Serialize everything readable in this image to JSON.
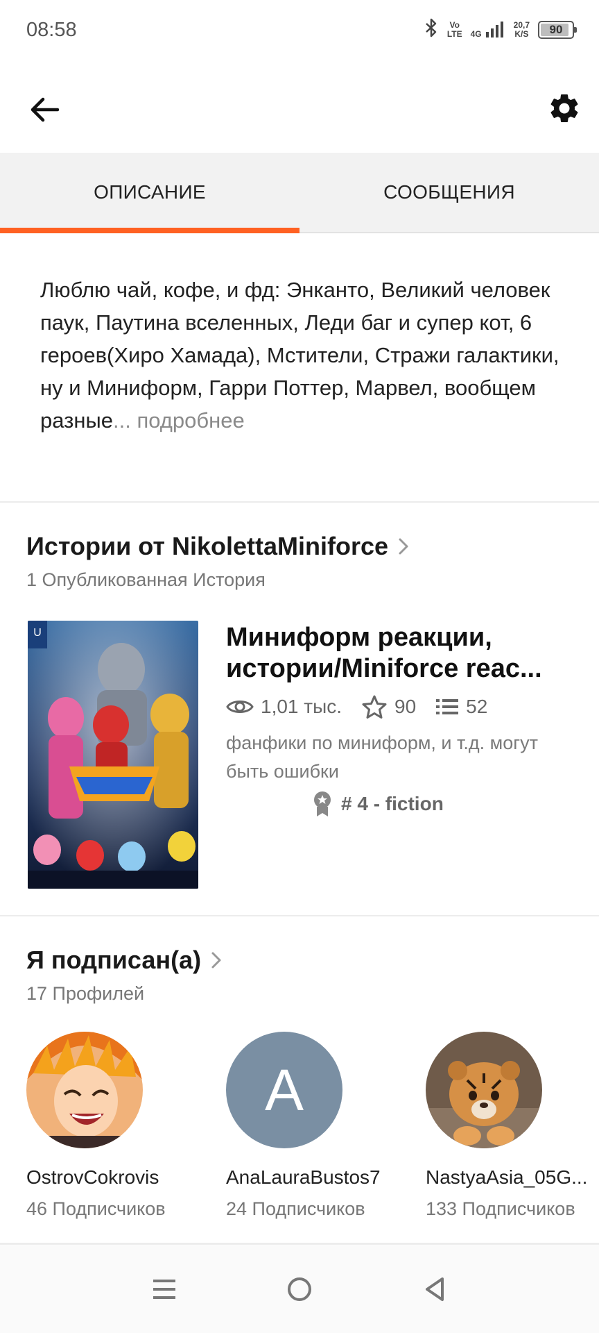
{
  "status_bar": {
    "time": "08:58",
    "volte_top": "Vo",
    "volte_bottom": "LTE",
    "network": "4G",
    "speed_value": "20,7",
    "speed_unit": "K/S",
    "battery": "90",
    "battery_level_percent": 90
  },
  "tabs": [
    {
      "label": "ОПИСАНИЕ",
      "active": true
    },
    {
      "label": "СООБЩЕНИЯ",
      "active": false
    }
  ],
  "description": {
    "text": "Люблю чай, кофе, и фд: Энканто, Великий человек паук, Паутина вселенных, Леди баг и супер кот, 6 героев(Хиро Хамада), Мстители, Стражи галактики, ну и Миниформ, Гарри Поттер, Марвел, вообщем разные",
    "ellipsis": "...",
    "more_label": " подробнее"
  },
  "stories_section": {
    "title": "Истории от NikolettaMiniforce",
    "subtitle": "1 Опубликованная История"
  },
  "story": {
    "title": "Миниформ реакции, истории/Miniforce reac...",
    "reads": "1,01 тыс.",
    "votes": "90",
    "parts": "52",
    "description": "фанфики по миниформ, и т.д. могут быть ошибки",
    "rank": "# 4 - fiction"
  },
  "following_section": {
    "title": "Я подписан(а)",
    "subtitle": "17 Профилей"
  },
  "profiles": [
    {
      "name": "OstrovCokrovis",
      "followers": "46 Подписчиков"
    },
    {
      "name": "AnaLauraBustos7",
      "followers": "24 Подписчиков",
      "initial": "A"
    },
    {
      "name": "NastyaAsia_05G...",
      "followers": "133 Подписчиков"
    }
  ],
  "colors": {
    "accent": "#ff6122",
    "avatar_placeholder": "#7a8fa3"
  },
  "icons": {
    "back": "arrow-left-icon",
    "settings": "gear-icon",
    "reads": "eye-icon",
    "votes": "star-icon",
    "parts": "list-icon",
    "rank": "medal-icon",
    "chevron": "chevron-right-icon",
    "nav_menu": "menu-icon",
    "nav_home": "home-circle-icon",
    "nav_back": "triangle-back-icon"
  }
}
